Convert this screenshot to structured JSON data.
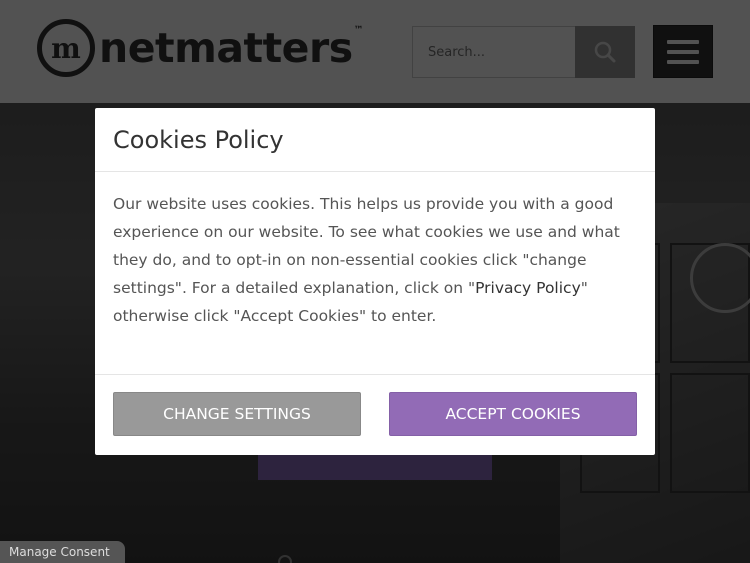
{
  "header": {
    "logo_text": "netmatters",
    "logo_tm": "™",
    "logo_mark": "m",
    "search": {
      "placeholder": "Search..."
    },
    "search_icon": "search-icon",
    "menu_icon": "hamburger-icon"
  },
  "modal": {
    "title": "Cookies Policy",
    "body_part1": "Our website uses cookies. This helps us provide you with a good experience on our website. To see what cookies we use and what they do, and to opt-in on non-essential cookies click \"change settings\". For a detailed explanation, click on \"",
    "privacy_link": "Privacy Policy",
    "body_part2": "\" otherwise click \"Accept Cookies\" to enter.",
    "change_settings_label": "CHANGE SETTINGS",
    "accept_cookies_label": "ACCEPT COOKIES"
  },
  "footer": {
    "manage_consent_label": "Manage Consent"
  },
  "colors": {
    "accent": "#926bb6",
    "secondary_button": "#999999",
    "text": "#555555"
  }
}
